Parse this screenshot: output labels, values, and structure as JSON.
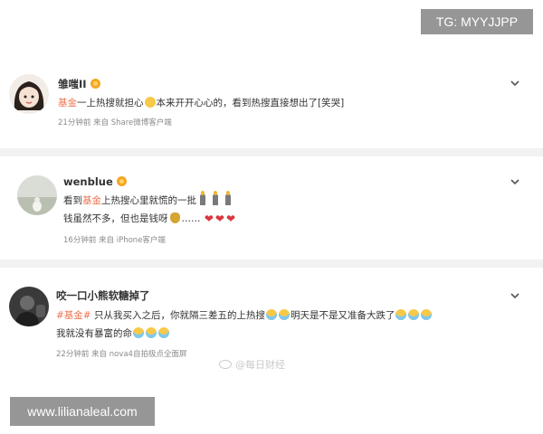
{
  "watermarks": {
    "tg": "TG: MYYJJPP",
    "site": "www.lilianaleal.com",
    "weibo": "@每日财经"
  },
  "posts": [
    {
      "username": "雏嗤II",
      "tag": "基金",
      "text_a": "一上热搜就担心",
      "text_b": "本来开开心心的，看到热搜直接想出了[笑哭]",
      "time": "21分钟前",
      "source": "来自 Share微博客户端"
    },
    {
      "username": "wenblue",
      "line1_a": "看到",
      "tag": "基金",
      "line1_b": "上热搜心里就慌的一批",
      "line2": "钱虽然不多，但也是钱呀",
      "line2_dots": "……",
      "time": "16分钟前",
      "source": "来自 iPhone客户端"
    },
    {
      "username": "咬一口小熊软糖掉了",
      "tag": "#基金#",
      "line1_a": "只从我买入之后，你就隔三差五的上热搜",
      "line1_b": "明天是不是又准备大跌了",
      "line2": "我就没有暴富的命",
      "time": "22分钟前",
      "source": "来自 nova4自拍极点全面屏"
    }
  ]
}
